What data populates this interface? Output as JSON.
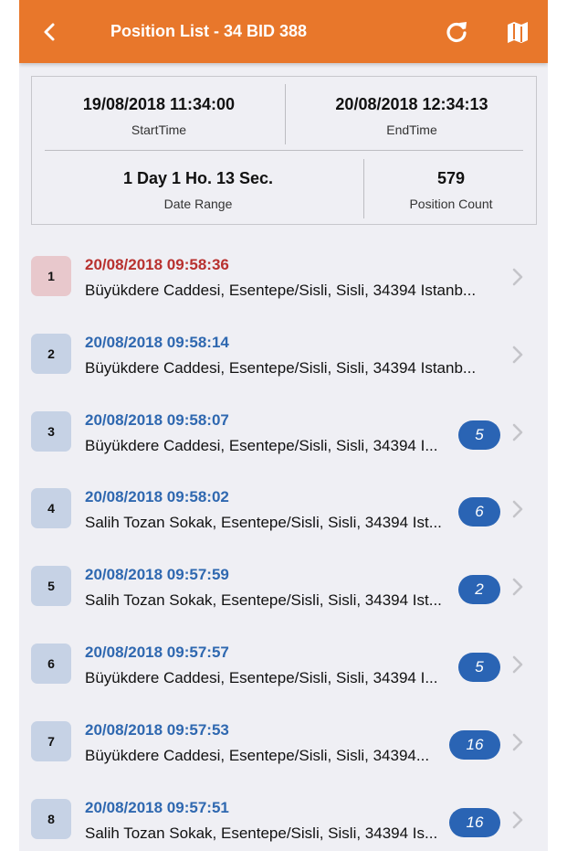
{
  "header": {
    "title": "Position List - 34 BID 388",
    "back_icon": "chevron-left-icon",
    "refresh_icon": "refresh-icon",
    "map_icon": "map-icon"
  },
  "summary": {
    "start_time": "19/08/2018 11:34:00",
    "start_label": "StartTime",
    "end_time": "20/08/2018 12:34:13",
    "end_label": "EndTime",
    "date_range": "1 Day 1 Ho. 13 Sec.",
    "date_range_label": "Date Range",
    "position_count": "579",
    "position_count_label": "Position Count"
  },
  "colors": {
    "header": "#e8772b",
    "time_first": "#b8312f",
    "time": "#2f68b0",
    "badge": "#2a64b4"
  },
  "positions": [
    {
      "index": "1",
      "time": "20/08/2018 09:58:36",
      "address": "Büyükdere Caddesi, Esentepe/Sisli, Sisli, 34394 Istanb...",
      "badge": ""
    },
    {
      "index": "2",
      "time": "20/08/2018 09:58:14",
      "address": "Büyükdere Caddesi, Esentepe/Sisli, Sisli, 34394 Istanb...",
      "badge": ""
    },
    {
      "index": "3",
      "time": "20/08/2018 09:58:07",
      "address": "Büyükdere Caddesi, Esentepe/Sisli, Sisli, 34394 I...",
      "badge": "5"
    },
    {
      "index": "4",
      "time": "20/08/2018 09:58:02",
      "address": "Salih Tozan Sokak, Esentepe/Sisli, Sisli, 34394 Ist...",
      "badge": "6"
    },
    {
      "index": "5",
      "time": "20/08/2018 09:57:59",
      "address": "Salih Tozan Sokak, Esentepe/Sisli, Sisli, 34394 Ist...",
      "badge": "2"
    },
    {
      "index": "6",
      "time": "20/08/2018 09:57:57",
      "address": "Büyükdere Caddesi, Esentepe/Sisli, Sisli, 34394 I...",
      "badge": "5"
    },
    {
      "index": "7",
      "time": "20/08/2018 09:57:53",
      "address": "Büyükdere Caddesi, Esentepe/Sisli, Sisli, 34394...",
      "badge": "16"
    },
    {
      "index": "8",
      "time": "20/08/2018 09:57:51",
      "address": "Salih Tozan Sokak, Esentepe/Sisli, Sisli, 34394 Is...",
      "badge": "16"
    }
  ]
}
